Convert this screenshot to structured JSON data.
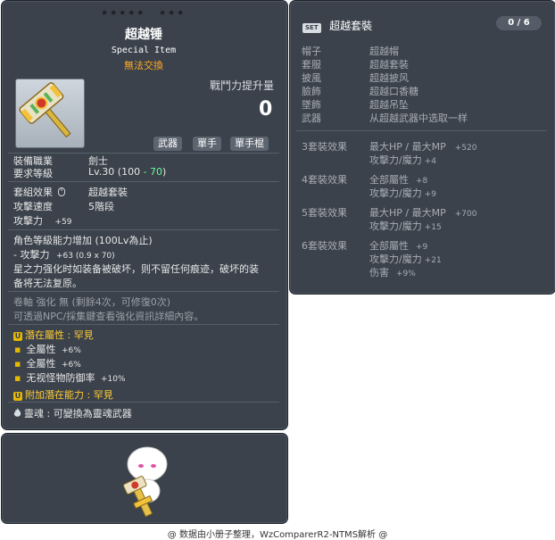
{
  "item_id": "01322260",
  "stars": {
    "group1": "★★★★★",
    "group2": "★★★"
  },
  "item": {
    "name": "超越锤",
    "subtitle": "Special Item",
    "tradability": "無法交換",
    "icon": "hammer-icon"
  },
  "combat_power": {
    "label": "戰鬥力提升量",
    "value": "0"
  },
  "tags": [
    "武器",
    "單手",
    "單手棍"
  ],
  "requirements": {
    "job_label": "裝備職業",
    "job_value": "劍士",
    "level_label": "要求等級",
    "level_prefix": "Lv.30 (100 ",
    "level_bonus": "- 70",
    "level_suffix": ")"
  },
  "stats": {
    "set_label": "套組效果",
    "set_value": "超越套裝",
    "speed_label": "攻擊速度",
    "speed_value": "5階段",
    "attack_label": "攻擊力",
    "attack_value": "+59"
  },
  "level_up": {
    "line1": "角色等級能力增加 (100Lv為止)",
    "line2_a": "- 攻擊力",
    "line2_b": "+63 (0.9 x 70)",
    "line3": "星之力强化时如装备被破坏，则不留任何痕迹，破坏的装",
    "line4": "备将无法复原。"
  },
  "scroll": {
    "line1": "卷軸 強化 無 (剩餘4次，可修復0次)",
    "line2": "可透過NPC/採集鍵查看強化資訊詳細內容。"
  },
  "potential": {
    "badge": "U",
    "label": "潛在屬性",
    "sep": " : ",
    "grade": "罕見",
    "lines": [
      {
        "text": "全屬性",
        "value": "+6%"
      },
      {
        "text": "全屬性",
        "value": "+6%"
      },
      {
        "text": "无视怪物防御率",
        "value": "+10%"
      }
    ]
  },
  "bonus_potential": {
    "badge": "U",
    "label": "附加潛在能力",
    "sep": " : ",
    "grade": "罕見"
  },
  "soul": {
    "label": "靈魂",
    "sep": " : ",
    "text": "可變換為靈魂武器",
    "icon": "flame-icon"
  },
  "set_panel": {
    "badge": "SET",
    "title": "超越套裝",
    "count": "0 / 6",
    "pieces": [
      {
        "slot": "帽子",
        "name": "超越帽"
      },
      {
        "slot": "套服",
        "name": "超越套裝"
      },
      {
        "slot": "披風",
        "name": "超越披风"
      },
      {
        "slot": "臉飾",
        "name": "超越口香糖"
      },
      {
        "slot": "墜飾",
        "name": "超越吊坠"
      },
      {
        "slot": "武器",
        "name": "从超越武器中选取一样"
      }
    ],
    "effects": [
      {
        "label": "3套裝效果",
        "lines": [
          {
            "text": "最大HP / 最大MP",
            "value": "+520"
          },
          {
            "text": "攻擊力/魔力",
            "value": "+4"
          }
        ]
      },
      {
        "label": "4套裝效果",
        "lines": [
          {
            "text": "全部屬性",
            "value": "+8"
          },
          {
            "text": "攻擊力/魔力",
            "value": "+9"
          }
        ]
      },
      {
        "label": "5套裝效果",
        "lines": [
          {
            "text": "最大HP / 最大MP",
            "value": "+700"
          },
          {
            "text": "攻擊力/魔力",
            "value": "+15"
          }
        ]
      },
      {
        "label": "6套裝效果",
        "lines": [
          {
            "text": "全部屬性",
            "value": "+9"
          },
          {
            "text": "攻擊力/魔力",
            "value": "+21"
          },
          {
            "text": "伤害",
            "value": "+9%"
          }
        ]
      }
    ]
  },
  "footer": "@ 数据由小册子整理，WzComparerR2-NTMS解析 @",
  "colors": {
    "panel": "#3b424c",
    "accent_orange": "#ffaa22",
    "green": "#66ff99",
    "yellow": "#ffcc33"
  }
}
